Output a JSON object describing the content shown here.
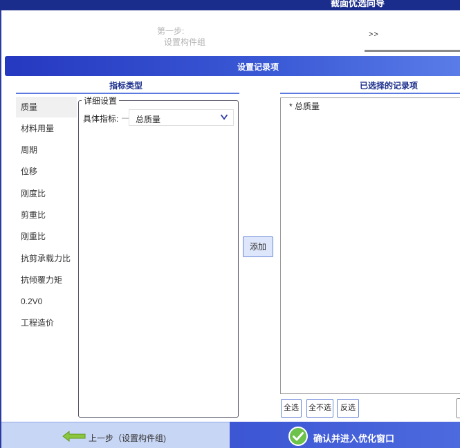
{
  "window": {
    "title": "截面优选向导"
  },
  "step": {
    "label": "第一步:",
    "value": "设置构件组",
    "next_arrows": ">>"
  },
  "section": {
    "title": "设置记录项"
  },
  "left_column": {
    "header": "指标类型"
  },
  "right_column": {
    "header": "已选择的记录项"
  },
  "metrics": [
    {
      "label": "质量",
      "selected": true
    },
    {
      "label": "材料用量"
    },
    {
      "label": "周期"
    },
    {
      "label": "位移"
    },
    {
      "label": "刚度比"
    },
    {
      "label": "剪重比"
    },
    {
      "label": "刚重比"
    },
    {
      "label": "抗剪承载力比"
    },
    {
      "label": "抗倾覆力矩"
    },
    {
      "label": "0.2V0"
    },
    {
      "label": "工程造价"
    }
  ],
  "details": {
    "legend": "详细设置",
    "specific_label": "具体指标:",
    "specific_dash": "—",
    "specific_value": "总质量"
  },
  "add_button": "添加",
  "selected_items": [
    "* 总质量"
  ],
  "list_buttons": {
    "select_all": "全选",
    "select_none": "全不选",
    "invert": "反选"
  },
  "footer": {
    "prev_label": "上一步（设置构件组)",
    "confirm_label": "确认并进入优化窗口"
  },
  "colors": {
    "title_bar": "#1a2d8c",
    "section_bar": "#2538c0",
    "accent_line": "#5b7ae0",
    "prev_bg": "#c8d6f5",
    "confirm_bg": "#3c56d4",
    "check_green": "#6cc24a",
    "arrow_green": "#8cc63f"
  }
}
